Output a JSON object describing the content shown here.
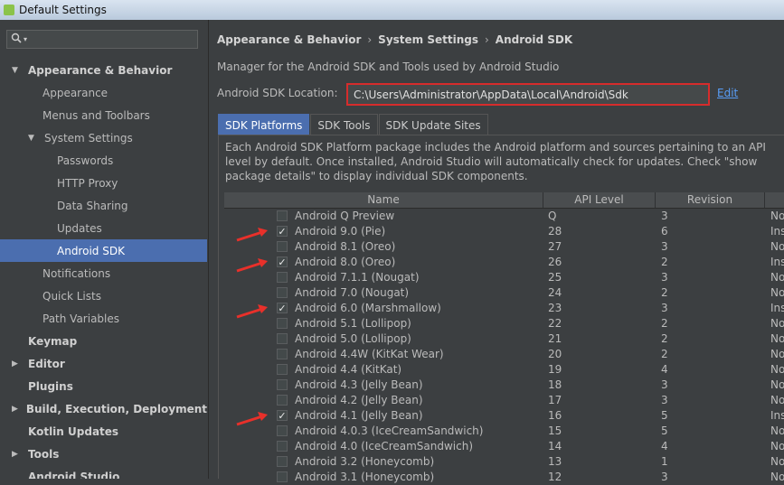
{
  "window": {
    "title": "Default Settings"
  },
  "search": {
    "icon": "search-icon",
    "value": ""
  },
  "sidebar": {
    "items": [
      {
        "label": "Appearance & Behavior",
        "indent": 0,
        "bold": true,
        "expanded": true,
        "arrow": "▼"
      },
      {
        "label": "Appearance",
        "indent": 1
      },
      {
        "label": "Menus and Toolbars",
        "indent": 1
      },
      {
        "label": "System Settings",
        "indent": 1,
        "expanded": true,
        "arrow": "▼"
      },
      {
        "label": "Passwords",
        "indent": 2
      },
      {
        "label": "HTTP Proxy",
        "indent": 2
      },
      {
        "label": "Data Sharing",
        "indent": 2
      },
      {
        "label": "Updates",
        "indent": 2
      },
      {
        "label": "Android SDK",
        "indent": 2,
        "selected": true
      },
      {
        "label": "Notifications",
        "indent": 1
      },
      {
        "label": "Quick Lists",
        "indent": 1
      },
      {
        "label": "Path Variables",
        "indent": 1
      },
      {
        "label": "Keymap",
        "indent": 0,
        "bold": true
      },
      {
        "label": "Editor",
        "indent": 0,
        "bold": true,
        "arrow": "▶"
      },
      {
        "label": "Plugins",
        "indent": 0,
        "bold": true
      },
      {
        "label": "Build, Execution, Deployment",
        "indent": 0,
        "bold": true,
        "arrow": "▶"
      },
      {
        "label": "Kotlin Updates",
        "indent": 0,
        "bold": true
      },
      {
        "label": "Tools",
        "indent": 0,
        "bold": true,
        "arrow": "▶"
      },
      {
        "label": "Android Studio",
        "indent": 0,
        "bold": true
      }
    ]
  },
  "breadcrumb": [
    "Appearance & Behavior",
    "System Settings",
    "Android SDK"
  ],
  "breadcrumb_sep": "›",
  "main": {
    "description": "Manager for the Android SDK and Tools used by Android Studio",
    "location_label": "Android SDK Location:",
    "location_value": "C:\\Users\\Administrator\\AppData\\Local\\Android\\Sdk",
    "edit_label": "Edit",
    "tabs": [
      {
        "label": "SDK Platforms",
        "active": true
      },
      {
        "label": "SDK Tools"
      },
      {
        "label": "SDK Update Sites"
      }
    ],
    "panel_description": "Each Android SDK Platform package includes the Android platform and sources pertaining to an API level by default. Once installed, Android Studio will automatically check for updates. Check \"show package details\" to display individual SDK components."
  },
  "table": {
    "columns": [
      "Name",
      "API Level",
      "Revision",
      ""
    ],
    "rows": [
      {
        "checked": false,
        "name": "Android Q Preview",
        "api": "Q",
        "revision": "3",
        "status": "No"
      },
      {
        "checked": true,
        "name": "Android 9.0 (Pie)",
        "api": "28",
        "revision": "6",
        "status": "Inst"
      },
      {
        "checked": false,
        "name": "Android 8.1 (Oreo)",
        "api": "27",
        "revision": "3",
        "status": "No"
      },
      {
        "checked": true,
        "name": "Android 8.0 (Oreo)",
        "api": "26",
        "revision": "2",
        "status": "Inst"
      },
      {
        "checked": false,
        "name": "Android 7.1.1 (Nougat)",
        "api": "25",
        "revision": "3",
        "status": "No"
      },
      {
        "checked": false,
        "name": "Android 7.0 (Nougat)",
        "api": "24",
        "revision": "2",
        "status": "No"
      },
      {
        "checked": true,
        "name": "Android 6.0 (Marshmallow)",
        "api": "23",
        "revision": "3",
        "status": "Inst"
      },
      {
        "checked": false,
        "name": "Android 5.1 (Lollipop)",
        "api": "22",
        "revision": "2",
        "status": "No"
      },
      {
        "checked": false,
        "name": "Android 5.0 (Lollipop)",
        "api": "21",
        "revision": "2",
        "status": "No"
      },
      {
        "checked": false,
        "name": "Android 4.4W (KitKat Wear)",
        "api": "20",
        "revision": "2",
        "status": "No"
      },
      {
        "checked": false,
        "name": "Android 4.4 (KitKat)",
        "api": "19",
        "revision": "4",
        "status": "No"
      },
      {
        "checked": false,
        "name": "Android 4.3 (Jelly Bean)",
        "api": "18",
        "revision": "3",
        "status": "No"
      },
      {
        "checked": false,
        "name": "Android 4.2 (Jelly Bean)",
        "api": "17",
        "revision": "3",
        "status": "No"
      },
      {
        "checked": true,
        "name": "Android 4.1 (Jelly Bean)",
        "api": "16",
        "revision": "5",
        "status": "Inst"
      },
      {
        "checked": false,
        "name": "Android 4.0.3 (IceCreamSandwich)",
        "api": "15",
        "revision": "5",
        "status": "No"
      },
      {
        "checked": false,
        "name": "Android 4.0 (IceCreamSandwich)",
        "api": "14",
        "revision": "4",
        "status": "No"
      },
      {
        "checked": false,
        "name": "Android 3.2 (Honeycomb)",
        "api": "13",
        "revision": "1",
        "status": "No"
      },
      {
        "checked": false,
        "name": "Android 3.1 (Honeycomb)",
        "api": "12",
        "revision": "3",
        "status": "No"
      }
    ]
  },
  "colors": {
    "selection": "#4b6eaf",
    "highlight_box": "#d62c2c",
    "annotation_arrow": "#e8302a",
    "link": "#589df6"
  }
}
